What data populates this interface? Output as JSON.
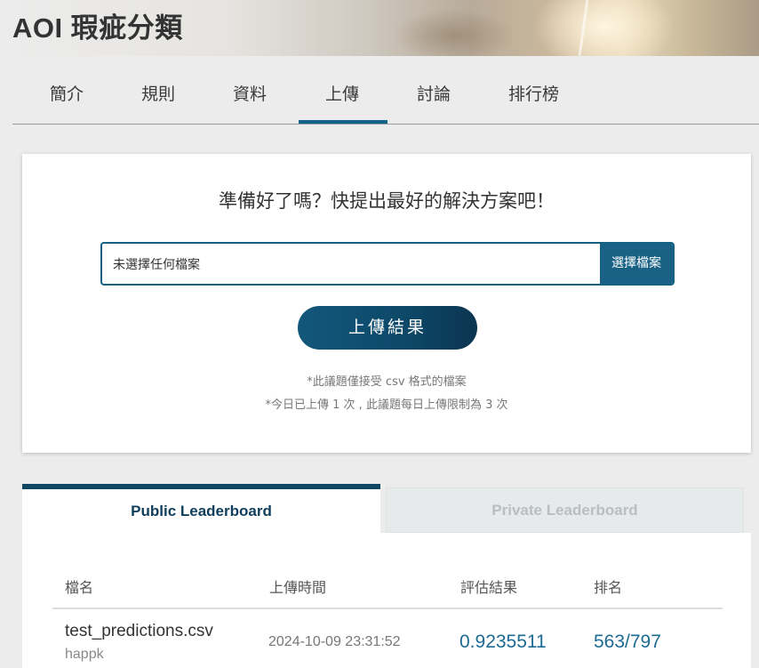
{
  "header": {
    "title": "AOI 瑕疵分類"
  },
  "tabs": [
    {
      "label": "簡介"
    },
    {
      "label": "規則"
    },
    {
      "label": "資料"
    },
    {
      "label": "上傳",
      "active": true
    },
    {
      "label": "討論"
    },
    {
      "label": "排行榜"
    }
  ],
  "upload": {
    "headline": "準備好了嗎？快提出最好的解決方案吧！",
    "file_status": "未選擇任何檔案",
    "choose_button": "選擇檔案",
    "submit_button": "上傳結果",
    "note_format": "*此議題僅接受 csv 格式的檔案",
    "note_limit": "*今日已上傳 1 次 , 此議題每日上傳限制為 3 次"
  },
  "leaderboard": {
    "public_tab": "Public Leaderboard",
    "private_tab": "Private Leaderboard",
    "columns": [
      "檔名",
      "上傳時間",
      "評估結果",
      "排名"
    ],
    "rows": [
      {
        "filename": "test_predictions.csv",
        "user": "happk",
        "time": "2024-10-09 23:31:52",
        "score": "0.9235511",
        "rank": "563/797"
      }
    ]
  },
  "colors": {
    "accent": "#13628a",
    "button_dark": "#0b3550",
    "score_text": "#1d6a93"
  }
}
